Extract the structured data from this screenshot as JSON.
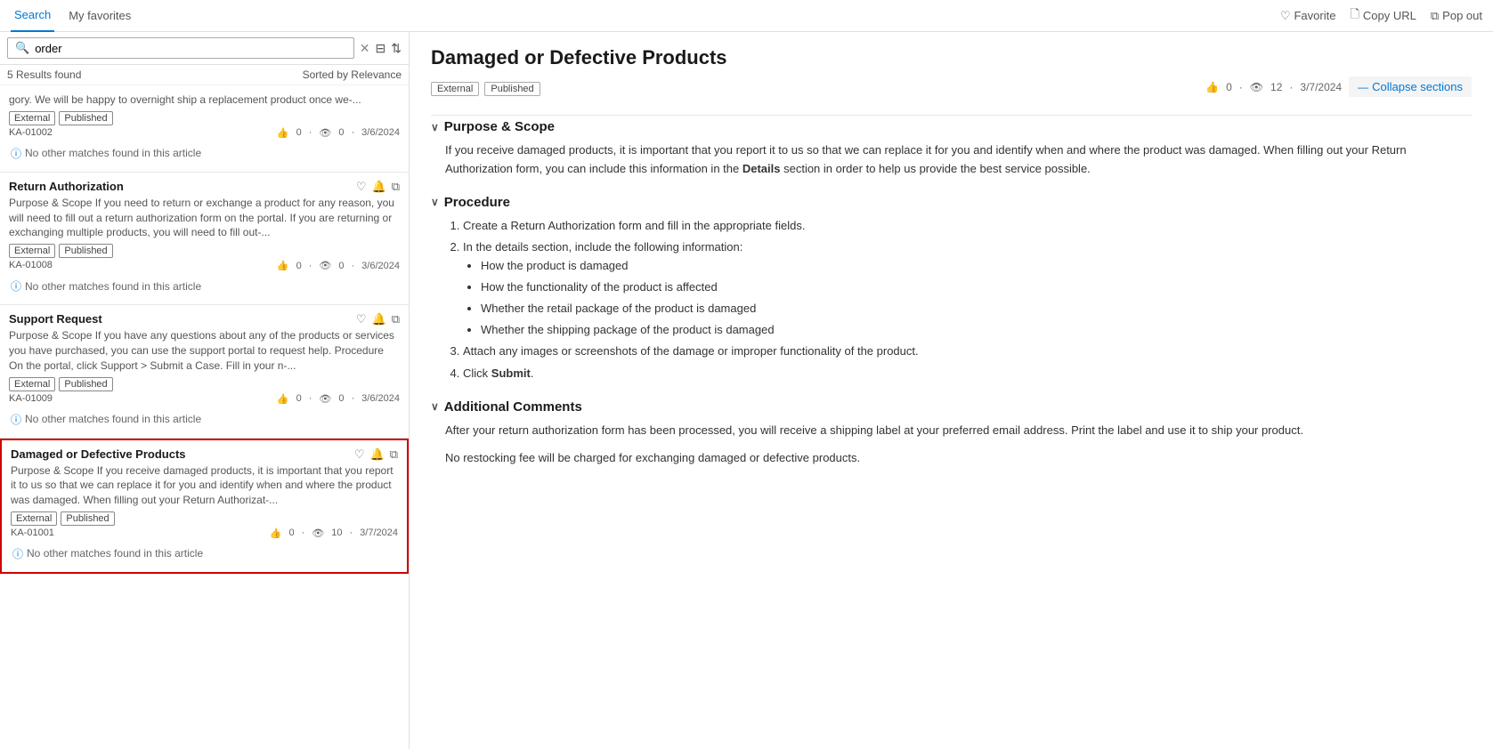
{
  "topbar": {
    "tab_search": "Search",
    "tab_favorites": "My favorites",
    "active_tab": "search",
    "action_favorite": "Favorite",
    "action_copy": "Copy URL",
    "action_popout": "Pop out"
  },
  "search": {
    "placeholder": "order",
    "results_count": "5 Results found",
    "sort_label": "Sorted by Relevance"
  },
  "results": [
    {
      "id": "ka01002",
      "title": null,
      "excerpt": "gory. We will be happy to overnight ship a replacement product once we-...",
      "badges": [
        "External",
        "Published"
      ],
      "ka_number": "KA-01002",
      "likes": "0",
      "views": "0",
      "date": "3/6/2024",
      "no_match": "No other matches found in this article",
      "selected": false
    },
    {
      "id": "ka01008",
      "title": "Return Authorization",
      "excerpt": "Purpose & Scope If you need to return or exchange a product for any reason, you will need to fill out a return authorization form on the portal. If you are returning or exchanging multiple products, you will need to fill out-...",
      "badges": [
        "External",
        "Published"
      ],
      "ka_number": "KA-01008",
      "likes": "0",
      "views": "0",
      "date": "3/6/2024",
      "no_match": "No other matches found in this article",
      "selected": false
    },
    {
      "id": "ka01009",
      "title": "Support Request",
      "excerpt": "Purpose & Scope If you have any questions about any of the products or services you have purchased, you can use the support portal to request help. Procedure On the portal, click Support > Submit a Case. Fill in your n-...",
      "badges": [
        "External",
        "Published"
      ],
      "ka_number": "KA-01009",
      "likes": "0",
      "views": "0",
      "date": "3/6/2024",
      "no_match": "No other matches found in this article",
      "selected": false
    },
    {
      "id": "ka01001",
      "title": "Damaged or Defective Products",
      "excerpt": "Purpose & Scope If you receive damaged products, it is important that you report it to us so that we can replace it for you and identify when and where the product was damaged. When filling out your Return Authorizat-...",
      "badges": [
        "External",
        "Published"
      ],
      "ka_number": "KA-01001",
      "likes": "0",
      "views": "10",
      "date": "3/7/2024",
      "no_match": "No other matches found in this article",
      "selected": true
    }
  ],
  "article": {
    "title": "Damaged or Defective Products",
    "tags": [
      "External",
      "Published"
    ],
    "likes": "0",
    "views": "12",
    "date": "3/7/2024",
    "collapse_sections_label": "Collapse sections",
    "sections": [
      {
        "id": "purpose",
        "title": "Purpose & Scope",
        "expanded": true,
        "content_paragraphs": [
          "If you receive damaged products, it is important that you report it to us so that we can replace it for you and identify when and where the product was damaged. When filling out your Return Authorization form, you can include this information in the Details section in order to help us provide the best service possible."
        ]
      },
      {
        "id": "procedure",
        "title": "Procedure",
        "expanded": true,
        "steps": [
          "Create a Return Authorization form and fill in the appropriate fields.",
          "In the details section, include the following information:"
        ],
        "sub_bullets": [
          "How the product is damaged",
          "How the functionality of the product is affected",
          "Whether the retail package of the product is damaged",
          "Whether the shipping package of the product is damaged"
        ],
        "steps_continued": [
          "Attach any images or screenshots of the damage or improper functionality of the product.",
          "Click Submit."
        ]
      },
      {
        "id": "additional",
        "title": "Additional Comments",
        "expanded": true,
        "content_paragraphs": [
          "After your return authorization form has been processed, you will receive a shipping label at your preferred email address. Print the label and use it to ship your product.",
          "No restocking fee will be charged for exchanging damaged or defective products."
        ]
      }
    ]
  }
}
